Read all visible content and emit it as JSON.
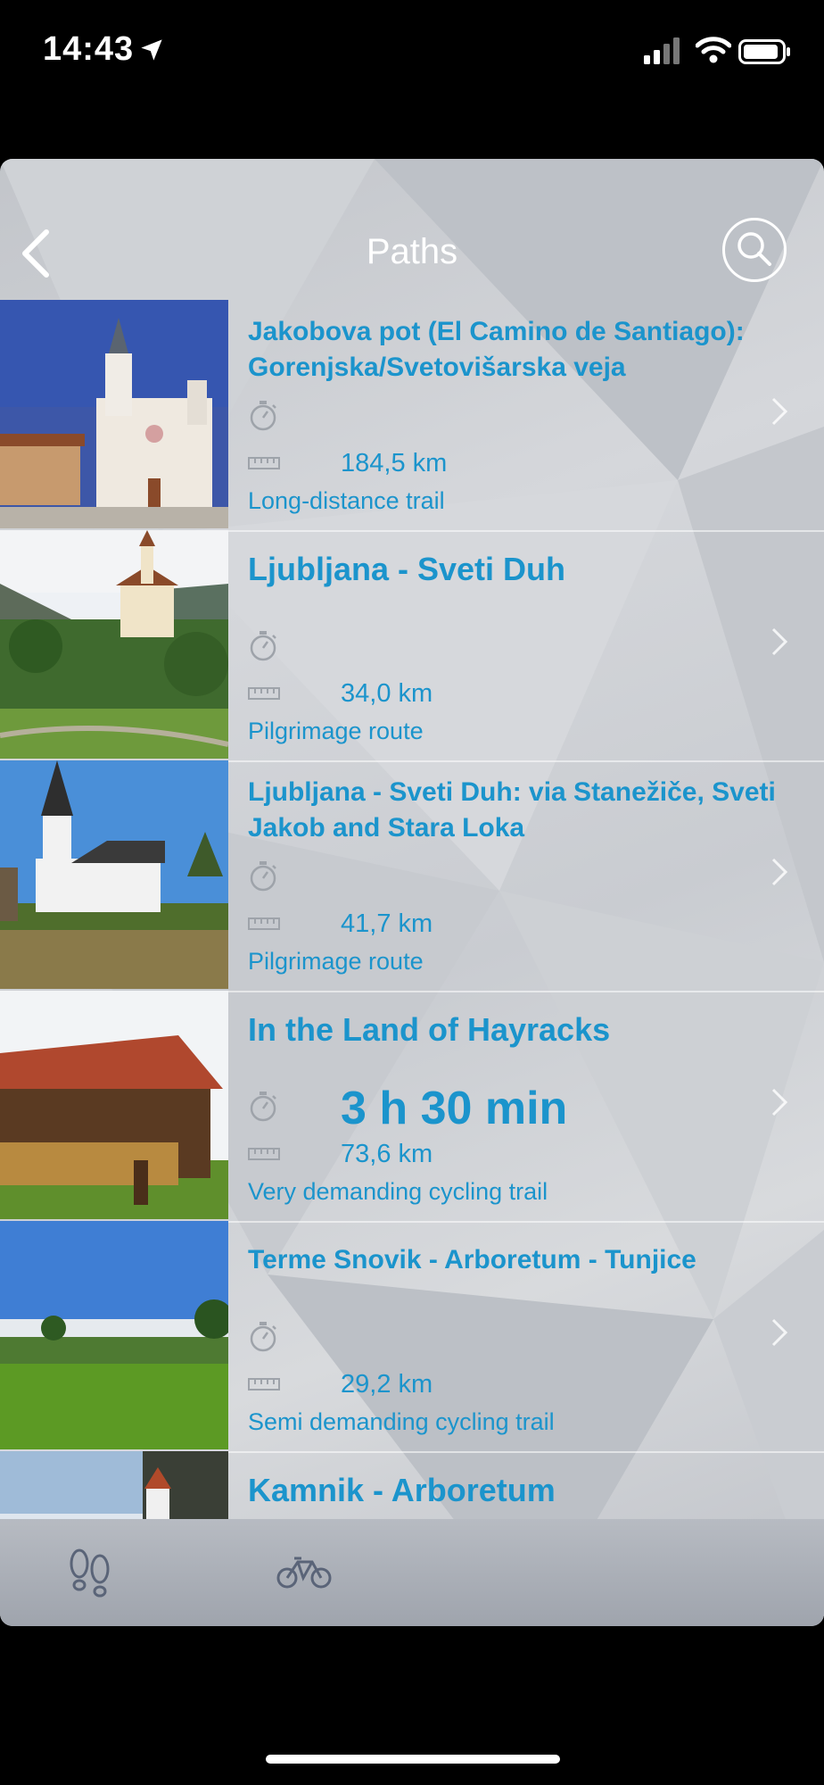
{
  "status_bar": {
    "time": "14:43"
  },
  "nav": {
    "title": "Paths"
  },
  "paths": [
    {
      "title": "Jakobova pot (El Camino de Santiago): Gorenjska/Svetovišarska veja",
      "duration": "",
      "distance": "184,5 km",
      "category": "Long-distance trail"
    },
    {
      "title": "Ljubljana - Sveti Duh",
      "duration": "",
      "distance": "34,0 km",
      "category": "Pilgrimage route"
    },
    {
      "title": "Ljubljana - Sveti Duh: via Stanežiče, Sveti Jakob and Stara Loka",
      "duration": "",
      "distance": "41,7 km",
      "category": "Pilgrimage route"
    },
    {
      "title": "In the Land of Hayracks",
      "duration": "3 h 30 min",
      "distance": "73,6 km",
      "category": "Very demanding cycling trail"
    },
    {
      "title": "Terme Snovik - Arboretum - Tunjice",
      "duration": "",
      "distance": "29,2 km",
      "category": "Semi demanding cycling trail"
    },
    {
      "title": "Kamnik - Arboretum",
      "duration": "",
      "distance": "",
      "category": ""
    }
  ],
  "tabs": {
    "hiking_icon": "footprints-icon",
    "cycling_icon": "bicycle-icon"
  },
  "colors": {
    "accent": "#1b94cc",
    "icon_gray": "#9ea3aa",
    "tab_icon": "#5a6478"
  }
}
